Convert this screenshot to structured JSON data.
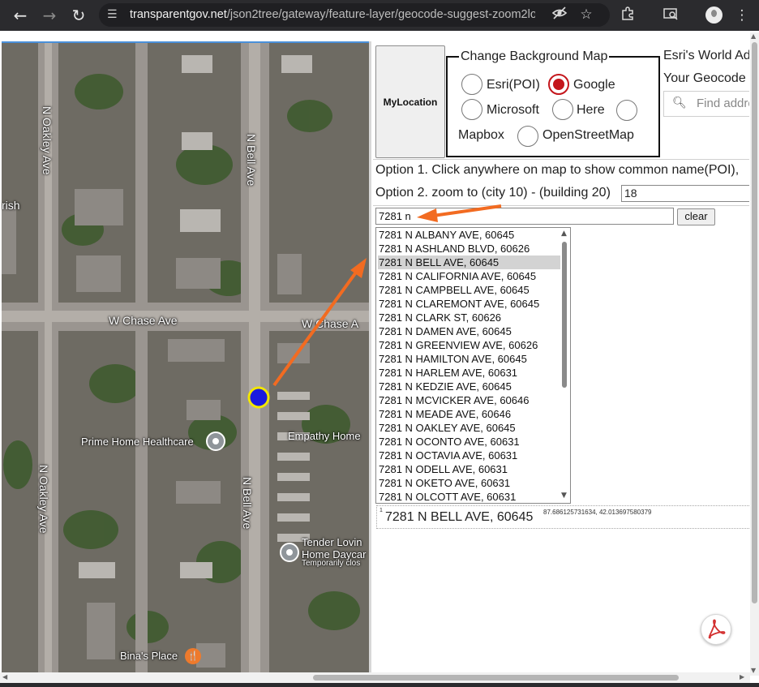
{
  "browser": {
    "url_domain": "transparentgov.net",
    "url_path": "/json2tree/gateway/feature-layer/geocode-suggest-zoom2lo..."
  },
  "map": {
    "labels": {
      "oakley_top": "N Oakley Ave",
      "oakley_bottom": "N Oakley Ave",
      "bell_top": "N Bell Ave",
      "bell_bottom": "N Bell Ave",
      "chase_left": "W Chase Ave",
      "chase_right": "W Chase A",
      "irish": "rish",
      "prime_home": "Prime Home Healthcare",
      "empathy_home": "Empathy Home",
      "tender_1": "Tender Lovin",
      "tender_2": "Home Daycar",
      "tender_3": "Temporarily clos",
      "binas_place": "Bina's Place"
    },
    "marker_color": "#1a1adf",
    "marker_ring_color": "#f2e600",
    "arrow_color": "#f26b21"
  },
  "panel": {
    "mylocation_label": "MyLocation",
    "background_map": {
      "legend": "Change Background Map",
      "options": [
        {
          "label": "Esri(POI)",
          "checked": false
        },
        {
          "label": "Google",
          "checked": true
        },
        {
          "label": "Microsoft",
          "checked": false
        },
        {
          "label": "Here",
          "checked": false
        },
        {
          "label": "Mapbox",
          "checked": false
        },
        {
          "label": "OpenStreetMap",
          "checked": false
        }
      ]
    },
    "world_title": "Esri's World Ad",
    "geocode_title": "Your Geocode",
    "find_placeholder": "Find addre",
    "option1": "Option 1. Click anywhere on map to show common name(POI),",
    "option2": "Option 2. zoom to (city 10) - (building 20)",
    "zoom_value": "18",
    "search_value": "7281 n",
    "clear_label": "clear",
    "suggestions": [
      "7281 N ALBANY AVE, 60645",
      "7281 N ASHLAND BLVD, 60626",
      "7281 N BELL AVE, 60645",
      "7281 N CALIFORNIA AVE, 60645",
      "7281 N CAMPBELL AVE, 60645",
      "7281 N CLAREMONT AVE, 60645",
      "7281 N CLARK ST, 60626",
      "7281 N DAMEN AVE, 60645",
      "7281 N GREENVIEW AVE, 60626",
      "7281 N HAMILTON AVE, 60645",
      "7281 N HARLEM AVE, 60631",
      "7281 N KEDZIE AVE, 60645",
      "7281 N MCVICKER AVE, 60646",
      "7281 N MEADE AVE, 60646",
      "7281 N OAKLEY AVE, 60645",
      "7281 N OCONTO AVE, 60631",
      "7281 N OCTAVIA AVE, 60631",
      "7281 N ODELL AVE, 60631",
      "7281 N OKETO AVE, 60631",
      "7281 N OLCOTT AVE, 60631"
    ],
    "selected_index": 2,
    "result": {
      "number": "1",
      "address": "7281 N BELL AVE, 60645",
      "coords": "87.686125731634, 42.013697580379"
    }
  }
}
